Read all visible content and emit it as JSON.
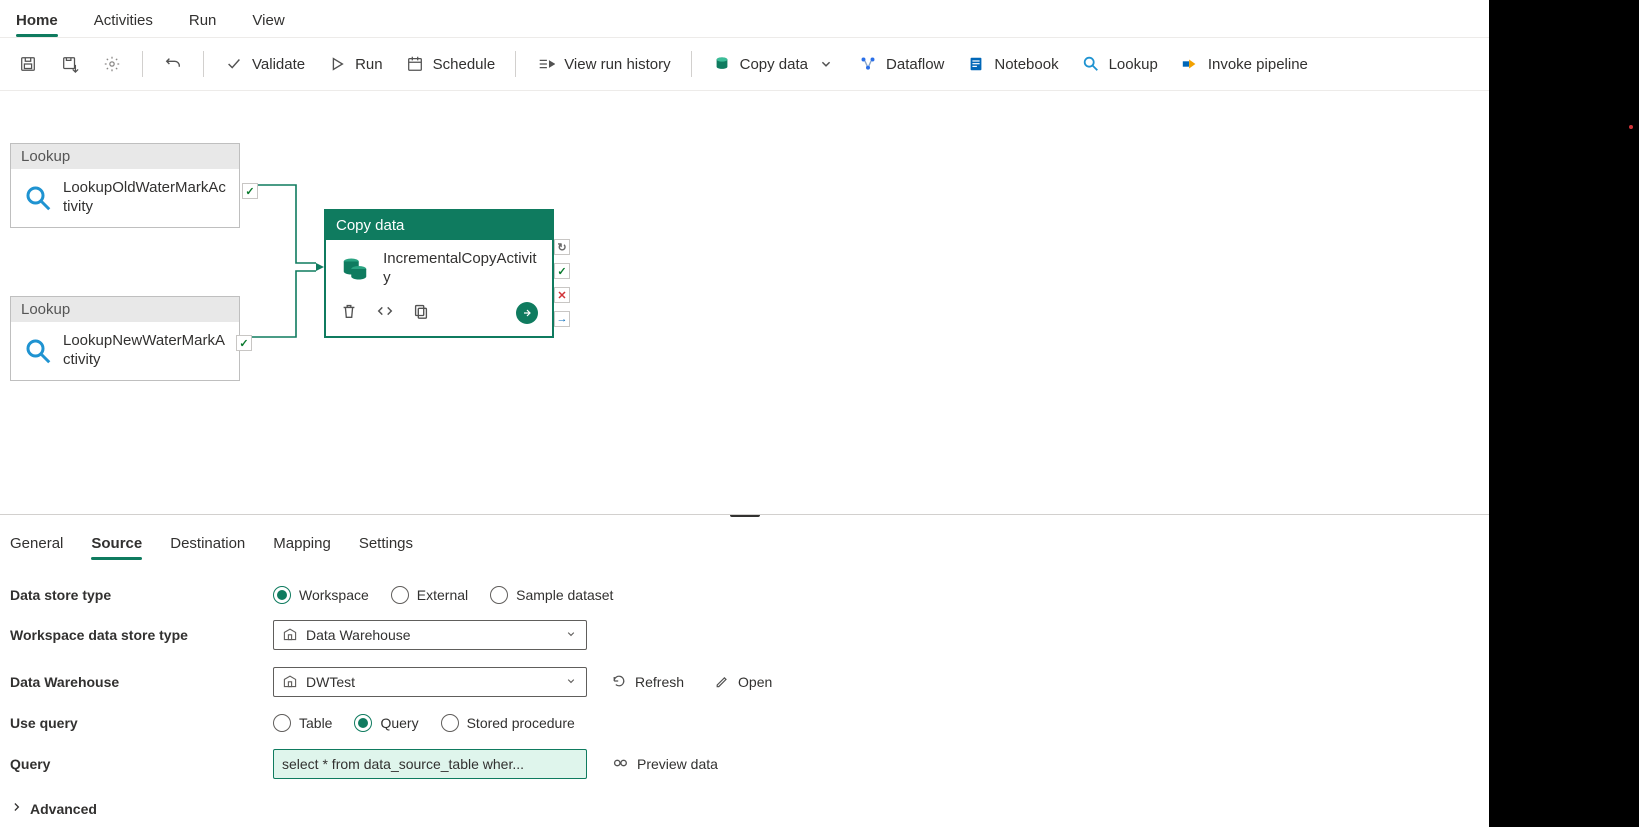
{
  "ribbon_tabs": {
    "home": "Home",
    "activities": "Activities",
    "run": "Run",
    "view": "View"
  },
  "toolbar": {
    "validate": "Validate",
    "run": "Run",
    "schedule": "Schedule",
    "view_run_history": "View run history",
    "copy_data": "Copy data",
    "dataflow": "Dataflow",
    "notebook": "Notebook",
    "lookup": "Lookup",
    "invoke_pipeline": "Invoke pipeline"
  },
  "canvas": {
    "lookup_header": "Lookup",
    "lookup1_name": "LookupOldWaterMarkActivity",
    "lookup2_name": "LookupNewWaterMarkActivity",
    "copy_header": "Copy data",
    "copy_name": "IncrementalCopyActivity"
  },
  "props_tabs": {
    "general": "General",
    "source": "Source",
    "destination": "Destination",
    "mapping": "Mapping",
    "settings": "Settings"
  },
  "source": {
    "data_store_type_label": "Data store type",
    "radios1": {
      "workspace": "Workspace",
      "external": "External",
      "sample": "Sample dataset"
    },
    "ws_type_label": "Workspace data store type",
    "ws_type_value": "Data Warehouse",
    "dw_label": "Data Warehouse",
    "dw_value": "DWTest",
    "refresh": "Refresh",
    "open": "Open",
    "use_query_label": "Use query",
    "radios2": {
      "table": "Table",
      "query": "Query",
      "sp": "Stored procedure"
    },
    "query_label": "Query",
    "query_value": "select * from data_source_table wher...",
    "preview": "Preview data",
    "advanced": "Advanced"
  }
}
